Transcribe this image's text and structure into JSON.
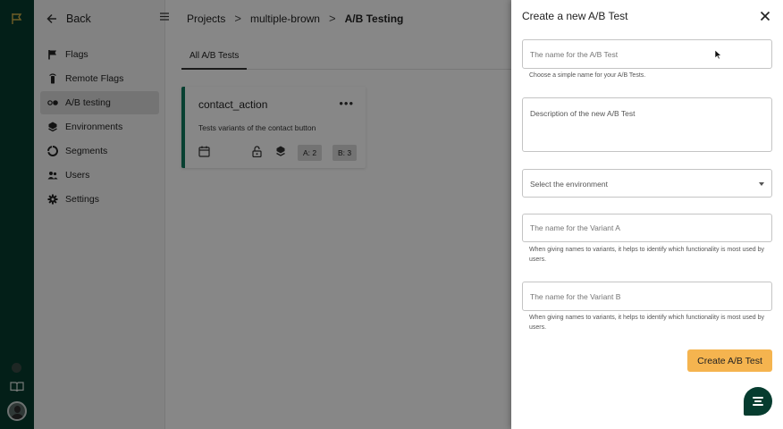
{
  "sidebar": {
    "back_label": "Back",
    "items": [
      {
        "label": "Flags",
        "icon": "flag-icon"
      },
      {
        "label": "Remote Flags",
        "icon": "remote-icon"
      },
      {
        "label": "A/B testing",
        "icon": "ab-icon",
        "active": true
      },
      {
        "label": "Environments",
        "icon": "environments-icon"
      },
      {
        "label": "Segments",
        "icon": "segments-icon"
      },
      {
        "label": "Users",
        "icon": "users-icon"
      },
      {
        "label": "Settings",
        "icon": "gear-icon"
      }
    ]
  },
  "breadcrumb": {
    "projects": "Projects",
    "project": "multiple-brown",
    "current": "A/B Testing",
    "separator": ">"
  },
  "tabs": {
    "all": "All A/B Tests"
  },
  "card": {
    "title": "contact_action",
    "menu": "•••",
    "description": "Tests variants of the contact button",
    "variant_a": "A: 2",
    "variant_b": "B: 3"
  },
  "drawer": {
    "title": "Create a new A/B Test",
    "name_placeholder": "The name for the A/B Test",
    "name_helper": "Choose a simple name for your A/B Tests.",
    "description_placeholder": "Description of the new A/B Test",
    "environment_placeholder": "Select the environment",
    "variant_a_placeholder": "The name for the Variant A",
    "variant_a_helper": "When giving names to variants, it helps to identify which functionality is most used by users.",
    "variant_b_placeholder": "The name for the Variant B",
    "variant_b_helper": "When giving names to variants, it helps to identify which functionality is most used by users.",
    "submit_label": "Create A/B Test"
  },
  "colors": {
    "brand_dark": "#063c2f",
    "accent_green": "#107a5e",
    "button_orange": "#f5b44f"
  }
}
